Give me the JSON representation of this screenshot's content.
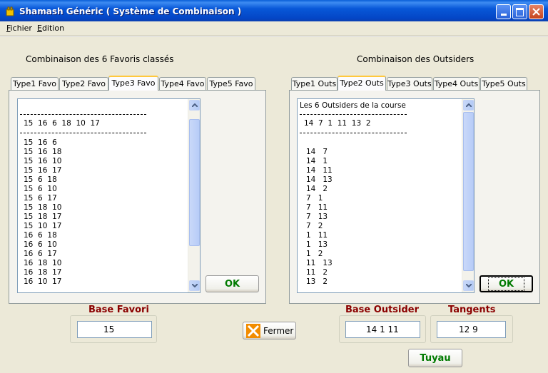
{
  "window": {
    "title": "Shamash Généric ( Système de Combinaison )"
  },
  "menu": [
    "Fichier",
    "Edition"
  ],
  "left": {
    "heading": "Combinaison des 6 Favoris classés",
    "tabs": [
      "Type1 Favo",
      "Type2 Favo",
      "Type3 Favo",
      "Type4 Favo",
      "Type5 Favo"
    ],
    "active_tab": "Type3 Favo",
    "header_line": "15  16  6  18  10  17",
    "items": [
      "15  16  6",
      "15  16  18",
      "15  16  10",
      "15  16  17",
      "15  6  18",
      "15  6  10",
      "15  6  17",
      "15  18  10",
      "15  18  17",
      "15  10  17",
      "16  6  18",
      "16  6  10",
      "16  6  17",
      "16  18  10",
      "16  18  17",
      "16  10  17"
    ],
    "ok_label": "OK"
  },
  "right": {
    "heading": "Combinaison des Outsiders",
    "tabs": [
      "Type1 Outs",
      "Type2 Outs",
      "Type3 Outs",
      "Type4 Outs",
      "Type5 Outs"
    ],
    "active_tab": "Type2 Outs",
    "intro": "Les 6 Outsiders de la course",
    "header_line": "14  7  1  11  13  2",
    "items": [
      "14   7",
      "14   1",
      "14   11",
      "14   13",
      "14   2",
      "7   1",
      "7   11",
      "7   13",
      "7   2",
      "1   11",
      "1   13",
      "1   2",
      "11   13",
      "11   2",
      "13   2"
    ],
    "ok_label": "OK"
  },
  "bottom": {
    "base_favori_label": "Base Favori",
    "base_favori_value": "15",
    "fermer_label": "Fermer",
    "base_outsider_label": "Base Outsider",
    "base_outsider_value": "14  1  11",
    "tangents_label": "Tangents",
    "tangents_value": "12  9",
    "tuyau_label": "Tuyau"
  },
  "colors": {
    "titlebar": "#0A5FD8",
    "caption": "#8B0000",
    "button_text_green": "#007A00"
  },
  "icons": [
    "app-icon",
    "minimize-icon",
    "maximize-icon",
    "close-icon",
    "scroll-up-icon",
    "scroll-down-icon",
    "fermer-x-icon"
  ]
}
